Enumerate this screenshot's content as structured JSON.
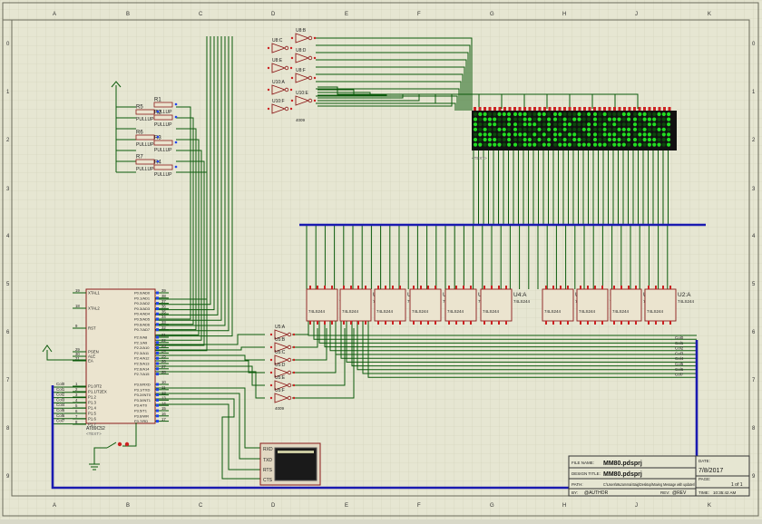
{
  "border": {
    "columns": [
      "A",
      "B",
      "C",
      "D",
      "E",
      "F",
      "G",
      "H",
      "J",
      "K"
    ],
    "rows": [
      "0",
      "1",
      "2",
      "3",
      "4",
      "5",
      "6",
      "7",
      "8",
      "9"
    ]
  },
  "mcu": {
    "name": "AT89C52",
    "text": "<TEXT>",
    "left_pins": [
      {
        "num": "19",
        "label": "XTAL1"
      },
      {
        "num": "18",
        "label": "XTAL2"
      },
      {
        "num": "9",
        "label": "RST"
      },
      {
        "num": "29",
        "label": "PSEN"
      },
      {
        "num": "30",
        "label": "ALE"
      },
      {
        "num": "31",
        "label": "EA"
      },
      {
        "num": "1",
        "label": "P1.0/T2"
      },
      {
        "num": "2",
        "label": "P1.1/T2EX"
      },
      {
        "num": "3",
        "label": "P1.2"
      },
      {
        "num": "4",
        "label": "P1.3"
      },
      {
        "num": "5",
        "label": "P1.4"
      },
      {
        "num": "6",
        "label": "P1.5"
      },
      {
        "num": "7",
        "label": "P1.6"
      },
      {
        "num": "8",
        "label": "P1.7"
      }
    ],
    "right_pins": [
      {
        "num": "39",
        "label": "P0.0/AD0"
      },
      {
        "num": "38",
        "label": "P0.1/AD1"
      },
      {
        "num": "37",
        "label": "P0.2/AD2"
      },
      {
        "num": "36",
        "label": "P0.3/AD3"
      },
      {
        "num": "35",
        "label": "P0.4/AD4"
      },
      {
        "num": "34",
        "label": "P0.5/AD5"
      },
      {
        "num": "33",
        "label": "P0.6/AD6"
      },
      {
        "num": "32",
        "label": "P0.7/AD7"
      },
      {
        "num": "21",
        "label": "P2.0/A8"
      },
      {
        "num": "22",
        "label": "P2.1/A9"
      },
      {
        "num": "23",
        "label": "P2.2/A10"
      },
      {
        "num": "24",
        "label": "P2.3/A11"
      },
      {
        "num": "25",
        "label": "P2.4/A12"
      },
      {
        "num": "26",
        "label": "P2.5/A13"
      },
      {
        "num": "27",
        "label": "P2.6/A14"
      },
      {
        "num": "28",
        "label": "P2.7/A15"
      },
      {
        "num": "10",
        "label": "P3.0/RXD"
      },
      {
        "num": "11",
        "label": "P3.1/TXD"
      },
      {
        "num": "12",
        "label": "P3.2/INT0"
      },
      {
        "num": "13",
        "label": "P3.3/INT1"
      },
      {
        "num": "14",
        "label": "P3.4/T0"
      },
      {
        "num": "15",
        "label": "P3.5/T1"
      },
      {
        "num": "16",
        "label": "P3.6/WR"
      },
      {
        "num": "17",
        "label": "P3.7/RD"
      }
    ]
  },
  "port_labels": [
    "Col0",
    "Col1",
    "Col2",
    "Col3",
    "Col4",
    "Col5",
    "Col6",
    "Col7"
  ],
  "resistors": [
    {
      "ref": "R1",
      "value": "PULLUP"
    },
    {
      "ref": "R2",
      "value": "PULLUP"
    },
    {
      "ref": "R3",
      "value": "PULLUP"
    },
    {
      "ref": "R4",
      "value": "PULLUP"
    },
    {
      "ref": "R5",
      "value": "PULLUP"
    },
    {
      "ref": "R6",
      "value": "PULLUP"
    },
    {
      "ref": "R7",
      "value": "PULLUP"
    }
  ],
  "inverters_top": [
    "U8:B",
    "U8:C",
    "U8:D",
    "U8:E",
    "U8:F",
    "U10:A",
    "U10:E",
    "U10:F"
  ],
  "inverters_bottom": [
    "U5:A",
    "U5:B",
    "U5:C",
    "U5:D",
    "U5:E",
    "U5:F"
  ],
  "inverter_part": "4009",
  "decoders": [
    {
      "ref": "U7:B",
      "part": "74LS244"
    },
    {
      "ref": "U7:A",
      "part": "74LS244"
    },
    {
      "ref": "U6:B",
      "part": "74LS244"
    },
    {
      "ref": "U6:A",
      "part": "74LS244"
    },
    {
      "ref": "U4:B",
      "part": "74LS244"
    },
    {
      "ref": "U4:A",
      "part": "74LS244"
    },
    {
      "ref": "U3:B",
      "part": "74LS244"
    },
    {
      "ref": "U3:A",
      "part": "74LS244"
    },
    {
      "ref": "U2:B",
      "part": "74LS244"
    },
    {
      "ref": "U2:A",
      "part": "74LS244"
    }
  ],
  "display": {
    "text": "<TEXT>"
  },
  "terminal": {
    "pins": [
      "RXD",
      "TXD",
      "RTS",
      "CTS"
    ]
  },
  "title_block": {
    "file_name_label": "FILE NAME:",
    "file_name": "MM80.pdsprj",
    "design_title_label": "DESIGN TITLE:",
    "design_title": "MM80.pdsprj",
    "path_label": "PATH:",
    "path": "C:\\Users\\Muzammal Baig\\Desktop\\Moving Message with updater\\",
    "by_label": "BY:",
    "by": "@AUTHOR",
    "rev_label": "REV:",
    "rev": "@REV",
    "date_label": "DATE:",
    "date": "7/8/2017",
    "page_label": "PAGE:",
    "page": "1 of 1",
    "time_label": "TIME:",
    "time": "10:35:42 AM"
  },
  "colors": {
    "sheet": "#e6e6d2",
    "grid": "#cdcdb4",
    "wire": "#0b5a0b",
    "component": "#8b1a1a",
    "bus": "#1a1ab0",
    "led_on": "#22dd22",
    "led_off": "#0b4a0b",
    "pin_blue": "#2244ee",
    "pin_red": "#cc2222"
  }
}
